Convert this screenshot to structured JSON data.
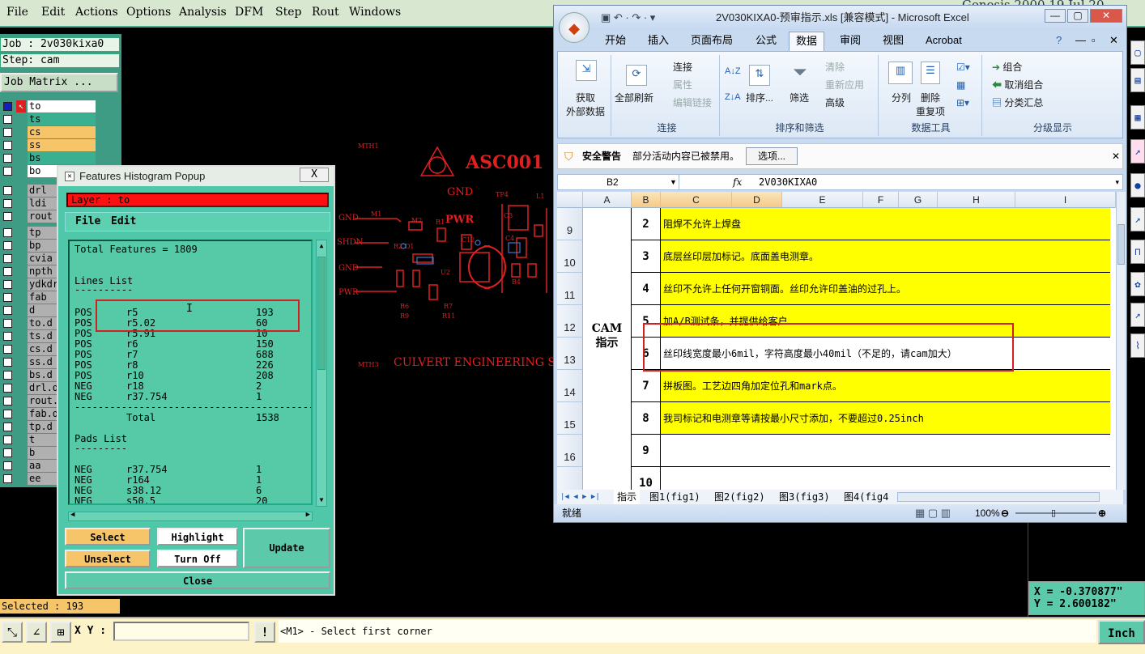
{
  "menubar": {
    "items": [
      "File",
      "Edit",
      "Actions",
      "Options",
      "Analysis",
      "DFM",
      "Step",
      "Rout",
      "Windows"
    ],
    "genesis_text": "Genesis 2000  19 Jul 20"
  },
  "left_panel": {
    "job": "Job : 2v030kixa0",
    "step": "Step: cam",
    "job_matrix": "Job Matrix ...",
    "layers": [
      {
        "name": "to",
        "color": "#ffffff"
      },
      {
        "name": "ts",
        "color": "#3ab090"
      },
      {
        "name": "cs",
        "color": "#f6c56a"
      },
      {
        "name": "ss",
        "color": "#f6c56a"
      },
      {
        "name": "bs",
        "color": "#3ab090"
      },
      {
        "name": "bo",
        "color": "#ffffff"
      },
      {
        "name": "drl",
        "color": "#b0b0b0"
      },
      {
        "name": "ldi",
        "color": "#b0b0b0"
      },
      {
        "name": "rout",
        "color": "#b0b0b0"
      },
      {
        "name": "tp",
        "color": "#b0b0b0"
      },
      {
        "name": "bp",
        "color": "#b0b0b0"
      },
      {
        "name": "cvia",
        "color": "#b0b0b0"
      },
      {
        "name": "npth",
        "color": "#b0b0b0"
      },
      {
        "name": "ydkdr",
        "color": "#b0b0b0"
      },
      {
        "name": "fab",
        "color": "#b0b0b0"
      },
      {
        "name": "d",
        "color": "#b0b0b0"
      },
      {
        "name": "to.d",
        "color": "#b0b0b0"
      },
      {
        "name": "ts.d",
        "color": "#b0b0b0"
      },
      {
        "name": "cs.d",
        "color": "#b0b0b0"
      },
      {
        "name": "ss.d",
        "color": "#b0b0b0"
      },
      {
        "name": "bs.d",
        "color": "#b0b0b0"
      },
      {
        "name": "drl.d",
        "color": "#b0b0b0"
      },
      {
        "name": "rout.",
        "color": "#b0b0b0"
      },
      {
        "name": "fab.d",
        "color": "#b0b0b0"
      },
      {
        "name": "tp.d",
        "color": "#b0b0b0"
      },
      {
        "name": "t",
        "color": "#b0b0b0"
      },
      {
        "name": "b",
        "color": "#b0b0b0"
      },
      {
        "name": "aa",
        "color": "#b0b0b0"
      },
      {
        "name": "ee",
        "color": "#b0b0b0"
      }
    ],
    "selected": "Selected : 193"
  },
  "canvas": {
    "labels": {
      "asc": "ASC001",
      "gnd1": "GND",
      "pwr1": "PWR",
      "gnd2": "GND",
      "shdn": "SHDN",
      "gnd3": "GND",
      "pwr2": "PWR",
      "culvert": "CULVERT ENGINEERING SOL",
      "mth1": "MTH1",
      "mth3": "MTH3",
      "m1": "M1",
      "m2": "M2",
      "r1": "R1",
      "c12": "C12",
      "u2": "U2",
      "d1": "D1",
      "r2": "R2",
      "l1": "L1",
      "tp4": "TP4",
      "c3": "C3",
      "c4": "C4",
      "b4": "B4",
      "r6": "R6",
      "r7": "R7",
      "r9": "R9",
      "r11": "R11"
    }
  },
  "popup": {
    "title": "Features Histogram Popup",
    "close_x": "X",
    "layer": "Layer :  to",
    "menu_file": "File",
    "menu_edit": "Edit",
    "total": "Total Features = 1809",
    "lines_header": "Lines List",
    "lines_rule": "----------",
    "lines": [
      {
        "pol": "POS",
        "sym": "r5",
        "cnt": "193"
      },
      {
        "pol": "POS",
        "sym": "r5.02",
        "cnt": "60"
      },
      {
        "pol": "POS",
        "sym": "r5.91",
        "cnt": "10"
      },
      {
        "pol": "POS",
        "sym": "r6",
        "cnt": "150"
      },
      {
        "pol": "POS",
        "sym": "r7",
        "cnt": "688"
      },
      {
        "pol": "POS",
        "sym": "r8",
        "cnt": "226"
      },
      {
        "pol": "POS",
        "sym": "r10",
        "cnt": "208"
      },
      {
        "pol": "NEG",
        "sym": "r18",
        "cnt": "2"
      },
      {
        "pol": "NEG",
        "sym": "r37.754",
        "cnt": "1"
      }
    ],
    "divider": "------------------------------------------",
    "total_label": "Total",
    "total_value": "1538",
    "pads_header": "Pads List",
    "pads_rule": "---------",
    "pads": [
      {
        "pol": "NEG",
        "sym": "r37.754",
        "cnt": "1"
      },
      {
        "pol": "NEG",
        "sym": "r164",
        "cnt": "1"
      },
      {
        "pol": "NEG",
        "sym": "s38.12",
        "cnt": "6"
      },
      {
        "pol": "NEG",
        "sym": "s50.5",
        "cnt": "20"
      }
    ],
    "buttons": {
      "select": "Select",
      "highlight": "Highlight",
      "update": "Update",
      "unselect": "Unselect",
      "turn_off": "Turn Off",
      "close": "Close"
    }
  },
  "coords": {
    "x": "X = -0.370877\"",
    "y": "Y = 2.600182\""
  },
  "statusbar": {
    "xy_label": "X Y :",
    "xy_value": "",
    "excl": "!",
    "message": "<M1> - Select first corner",
    "units": "Inch"
  },
  "excel": {
    "title": "2V030KIXA0-预审指示.xls  [兼容模式] - Microsoft Excel",
    "tabs": [
      "开始",
      "插入",
      "页面布局",
      "公式",
      "数据",
      "审阅",
      "视图",
      "Acrobat"
    ],
    "selected_tab": "数据",
    "ribbon": {
      "g1": {
        "btn": "获取\n外部数据"
      },
      "g2": {
        "refresh": "全部刷新",
        "connect": "连接",
        "props": "属性",
        "editlinks": "编辑链接",
        "label": "连接"
      },
      "g3": {
        "sort": "排序...",
        "filter": "筛选",
        "clear": "清除",
        "reapply": "重新应用",
        "advanced": "高级",
        "label": "排序和筛选"
      },
      "g4": {
        "split": "分列",
        "remove": "删除\n重复项",
        "label": "数据工具"
      },
      "g5": {
        "group": "组合",
        "ungroup": "取消组合",
        "subtotal": "分类汇总",
        "label": "分级显示"
      }
    },
    "security": {
      "title": "安全警告",
      "text": "部分活动内容已被禁用。",
      "options": "选项..."
    },
    "namebox": "B2",
    "fx": "fx",
    "formula": "2V030KIXA0",
    "columns": [
      "A",
      "B",
      "C",
      "D",
      "E",
      "F",
      "G",
      "H",
      "I"
    ],
    "merged_a": "CAM\n指示",
    "rows": [
      {
        "row": "9",
        "num": "2",
        "text": "阻焊不允许上焊盘",
        "yellow": true
      },
      {
        "row": "10",
        "num": "3",
        "text": "底层丝印层加标记。底面盖电测章。",
        "yellow": true
      },
      {
        "row": "11",
        "num": "4",
        "text": "丝印不允许上任何开窗铜面。丝印允许印盖油的过孔上。",
        "yellow": true
      },
      {
        "row": "12",
        "num": "5",
        "text": "加A/B测试条，并提供给客户",
        "yellow": true
      },
      {
        "row": "13",
        "num": "6",
        "text": "丝印线宽度最小6mil，字符高度最小40mil（不足的，请cam加大）",
        "yellow": false
      },
      {
        "row": "14",
        "num": "7",
        "text": "拼板图。工艺边四角加定位孔和mark点。",
        "yellow": true
      },
      {
        "row": "15",
        "num": "8",
        "text": "我司标记和电测章等请按最小尺寸添加，不要超过0.25inch",
        "yellow": true
      },
      {
        "row": "16",
        "num": "9",
        "text": "",
        "yellow": false
      },
      {
        "row": "",
        "num": "10",
        "text": "",
        "yellow": false
      }
    ],
    "sheet_tabs": [
      "指示",
      "图1(fig1)",
      "图2(fig2)",
      "图3(fig3)",
      "图4(fig4"
    ],
    "status": "就绪",
    "zoom": "100%"
  }
}
